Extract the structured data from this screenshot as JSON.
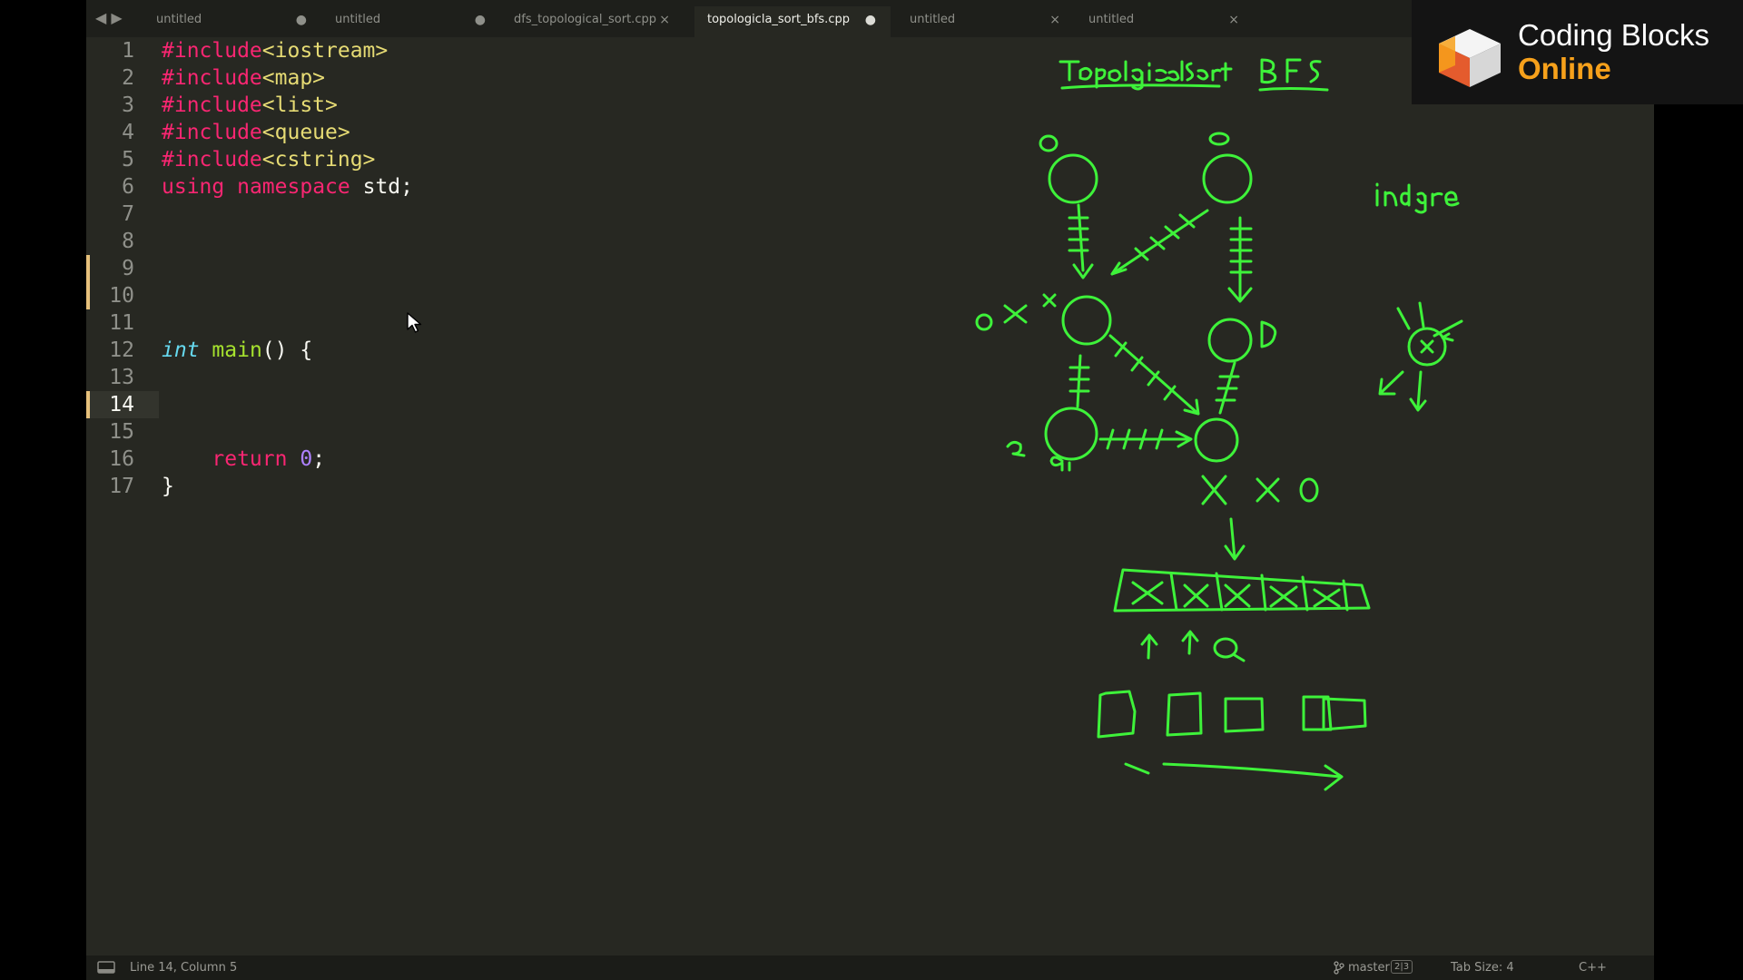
{
  "tabs": [
    {
      "label": "untitled",
      "indicator": "●",
      "active": false
    },
    {
      "label": "untitled",
      "indicator": "●",
      "active": false
    },
    {
      "label": "dfs_topological_sort.cpp",
      "indicator": "×",
      "active": false
    },
    {
      "label": "topologicla_sort_bfs.cpp",
      "indicator": "●",
      "active": true
    },
    {
      "label": "untitled",
      "indicator": "×",
      "active": false
    },
    {
      "label": "untitled",
      "indicator": "×",
      "active": false
    }
  ],
  "nav_arrows": "◀ ▶",
  "line_numbers": [
    "1",
    "2",
    "3",
    "4",
    "5",
    "6",
    "7",
    "8",
    "9",
    "10",
    "11",
    "12",
    "13",
    "14",
    "15",
    "16",
    "17"
  ],
  "code": {
    "l1": {
      "a": "#include",
      "b": "<iostream>"
    },
    "l2": {
      "a": "#include",
      "b": "<map>"
    },
    "l3": {
      "a": "#include",
      "b": "<list>"
    },
    "l4": {
      "a": "#include",
      "b": "<queue>"
    },
    "l5": {
      "a": "#include",
      "b": "<cstring>"
    },
    "l6": {
      "a": "using",
      "b": "namespace",
      "c": "std;"
    },
    "l12": {
      "a": "int",
      "b": "main",
      "c": "() {"
    },
    "l16": {
      "a": "return",
      "b": "0",
      ";": ";"
    },
    "l17": "}"
  },
  "status": {
    "position": "Line 14, Column 5",
    "branch": "master",
    "branch_badge": "2|3",
    "tab_size": "Tab Size: 4",
    "syntax": "C++"
  },
  "logo": {
    "line1": "Coding Blocks",
    "line2": "Online"
  },
  "colors": {
    "editor_bg": "#272822",
    "ink": "#3ef23a",
    "keyword": "#f92672",
    "string": "#e6db74",
    "type": "#66d9ef",
    "function": "#a6e22e",
    "number": "#ae81ff",
    "logo_accent": "#f7a11b"
  },
  "icons": {
    "status_left": "panel-icon",
    "branch": "git-branch-icon",
    "pointer": "mouse-pointer-icon"
  }
}
